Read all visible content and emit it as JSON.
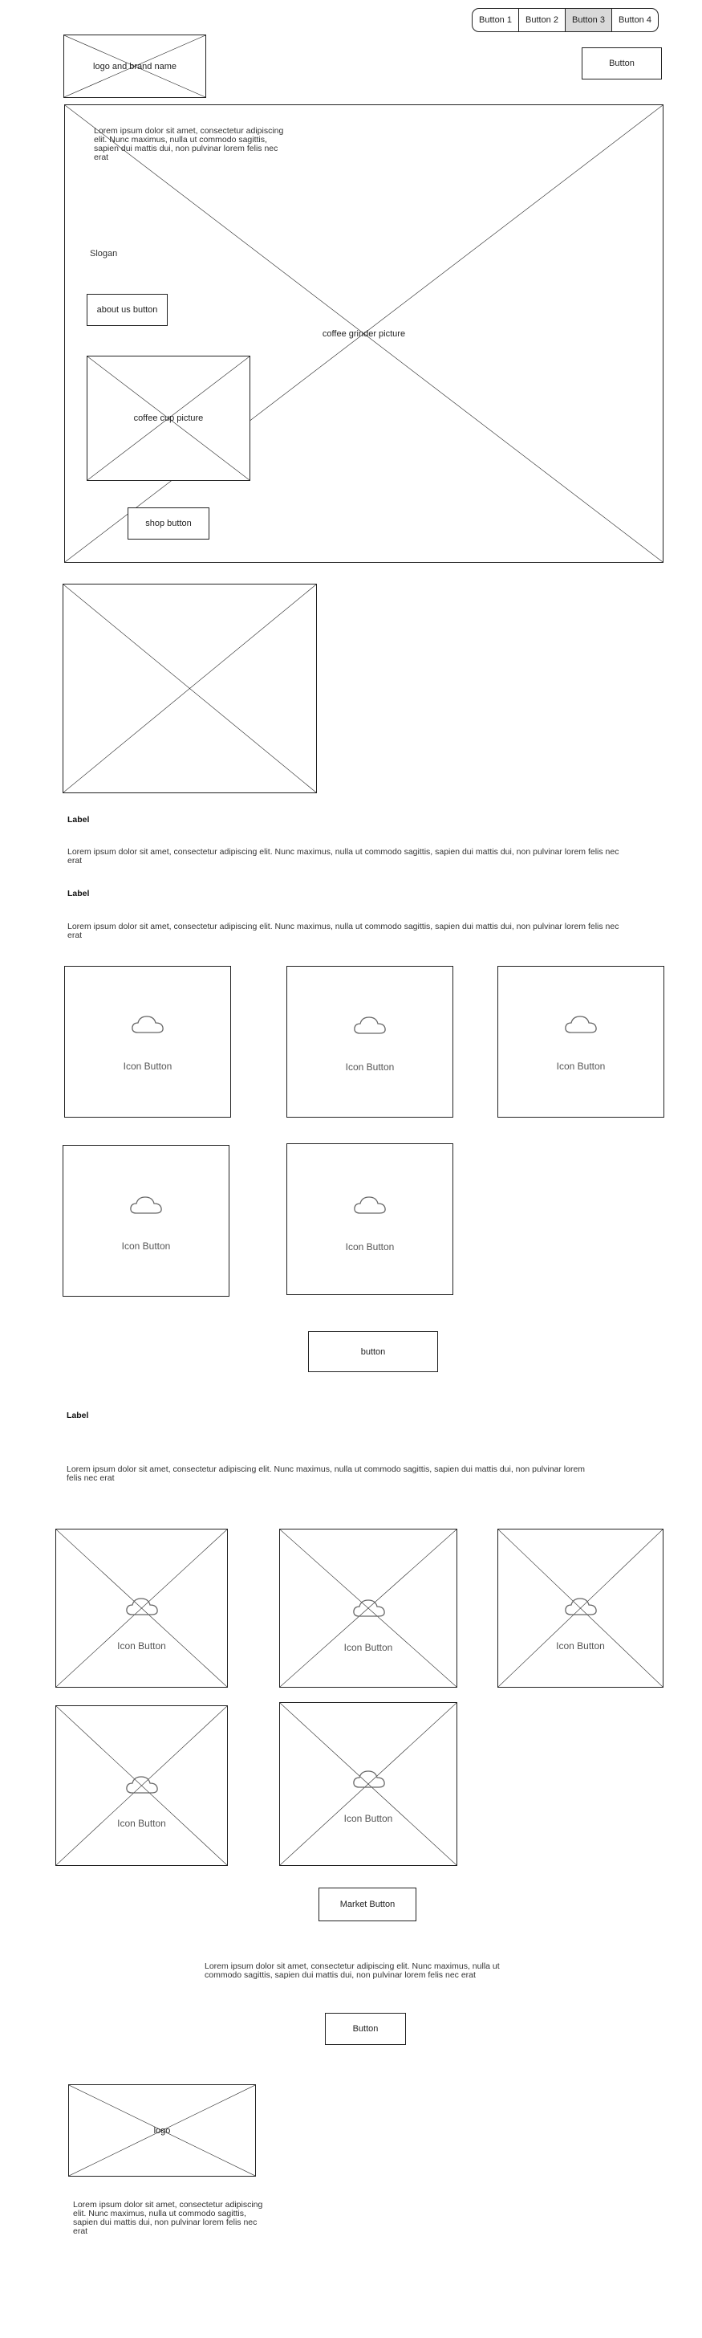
{
  "nav": {
    "buttons": [
      {
        "label": "Button 1"
      },
      {
        "label": "Button 2"
      },
      {
        "label": "Button 3"
      },
      {
        "label": "Button 4"
      }
    ],
    "active_index": 2
  },
  "header": {
    "logo_brand_label": "logo and brand name",
    "action_button": "Button"
  },
  "hero": {
    "text": "Lorem ipsum dolor sit amet, consectetur adipiscing elit. Nunc maximus, nulla ut commodo sagittis, sapien dui mattis dui, non pulvinar lorem felis nec erat",
    "slogan": "Slogan",
    "about_button": "about us button",
    "background_label": "coffee grinder picture",
    "cup_label": "coffee cup picture",
    "shop_button": "shop button"
  },
  "info": [
    {
      "label": "Label",
      "text": "Lorem ipsum dolor sit amet, consectetur adipiscing elit. Nunc maximus, nulla ut commodo sagittis, sapien dui mattis dui, non pulvinar lorem felis nec erat"
    },
    {
      "label": "Label",
      "text": "Lorem ipsum dolor sit amet, consectetur adipiscing elit. Nunc maximus, nulla ut commodo sagittis, sapien dui mattis dui, non pulvinar lorem felis nec erat"
    }
  ],
  "icon_buttons": {
    "label": "Icon Button",
    "icon": "cloud-icon",
    "more_button": "button"
  },
  "market": {
    "label": "Label",
    "text": "Lorem ipsum dolor sit amet, consectetur adipiscing elit. Nunc maximus, nulla ut commodo sagittis, sapien dui mattis dui, non pulvinar lorem felis nec erat",
    "card_label": "Icon Button",
    "icon": "cloud-icon",
    "market_button": "Market Button"
  },
  "cta": {
    "text": "Lorem ipsum dolor sit amet, consectetur adipiscing elit. Nunc maximus, nulla ut commodo sagittis, sapien dui mattis dui, non pulvinar lorem felis nec erat",
    "button": "Button"
  },
  "footer": {
    "logo_label": "logo",
    "text": "Lorem ipsum dolor sit amet, consectetur adipiscing elit. Nunc maximus, nulla ut commodo sagittis, sapien dui mattis dui, non pulvinar lorem felis nec erat"
  }
}
